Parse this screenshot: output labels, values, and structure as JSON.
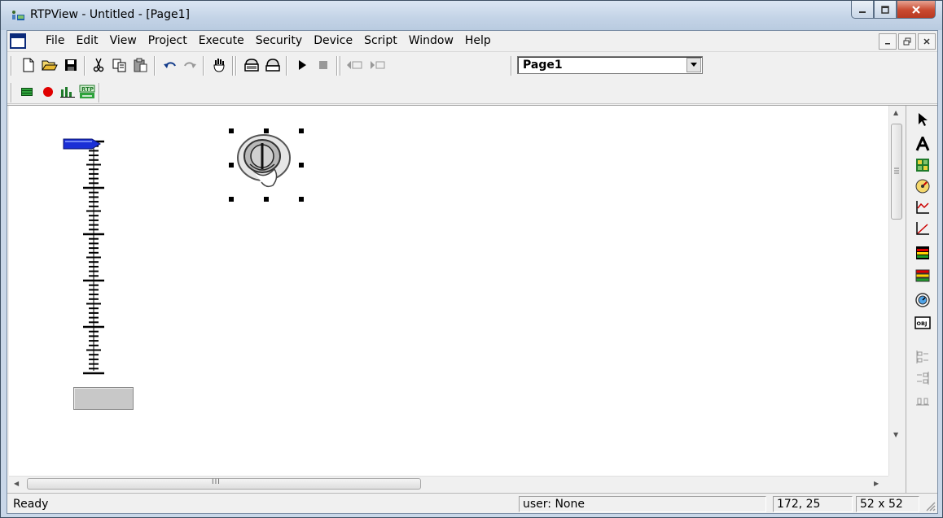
{
  "window": {
    "title": "RTPView  -  Untitled - [Page1]"
  },
  "menubar": {
    "items": [
      "File",
      "Edit",
      "View",
      "Project",
      "Execute",
      "Security",
      "Device",
      "Script",
      "Window",
      "Help"
    ]
  },
  "toolbar": {
    "page_selector_value": "Page1"
  },
  "canvas": {
    "scroll_marker": "III"
  },
  "statusbar": {
    "status": "Ready",
    "user": "user: None",
    "position": "172, 25",
    "size": "52 x 52"
  },
  "colors": {
    "slider_pointer": "#1a2fd6",
    "record": "#e00000",
    "accent_green": "#1f9b2a"
  },
  "icons": {
    "toolbar1": [
      "new-icon",
      "open-icon",
      "save-icon",
      "cut-icon",
      "copy-icon",
      "paste-icon",
      "undo-icon",
      "redo-icon",
      "hand-icon",
      "print-icon",
      "print-preview-icon",
      "run-icon",
      "stop-icon",
      "prev-page-icon",
      "next-page-icon"
    ],
    "toolbar2": [
      "tag-list-icon",
      "record-icon",
      "bar-chart-icon",
      "rtp-icon"
    ],
    "toolbox": [
      "pointer-tool-icon",
      "text-tool-icon",
      "image-tool-icon",
      "gauge-tool-icon",
      "trend-tool-icon",
      "xy-plot-tool-icon",
      "alarm-tool-icon",
      "bar-tool-icon",
      "dial-tool-icon",
      "object-tool-icon",
      "align-left-tool-icon",
      "align-right-tool-icon",
      "align-bottom-tool-icon"
    ]
  }
}
